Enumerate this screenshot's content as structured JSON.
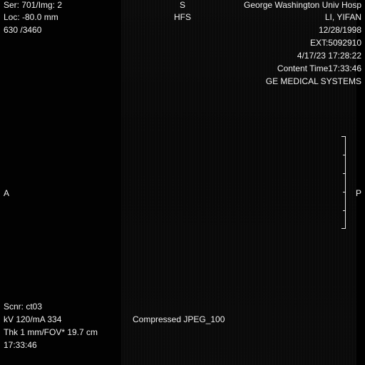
{
  "overlay": {
    "top_left": {
      "series_image": "Ser: 701/Img: 2",
      "location": "Loc: -80.0 mm",
      "window": "630  /3460"
    },
    "top_center": {
      "orientation": "S",
      "patient_position": "HFS"
    },
    "top_right": {
      "institution": "George Washington Univ Hosp",
      "patient_name": "LI, YIFAN",
      "dob": "12/28/1998",
      "patient_id": "EXT:5092910",
      "acquisition_datetime": "4/17/23 17:28:22",
      "content_time": "Content Time17:33:46",
      "manufacturer": "GE MEDICAL SYSTEMS"
    },
    "side_left": {
      "orientation": "A"
    },
    "side_right": {
      "orientation": "P"
    },
    "bottom_left": {
      "scanner": "Scnr: ct03",
      "kv_ma": "kV 120/mA 334",
      "thickness_fov": "Thk 1 mm/FOV* 19.7 cm",
      "time": "17:33:46"
    },
    "bottom_center": {
      "compression": "Compressed JPEG_100"
    }
  },
  "colors": {
    "background": "#000000",
    "overlay_text": "#f0f0f0"
  },
  "icons": {
    "ruler": "scale-ruler-icon"
  }
}
